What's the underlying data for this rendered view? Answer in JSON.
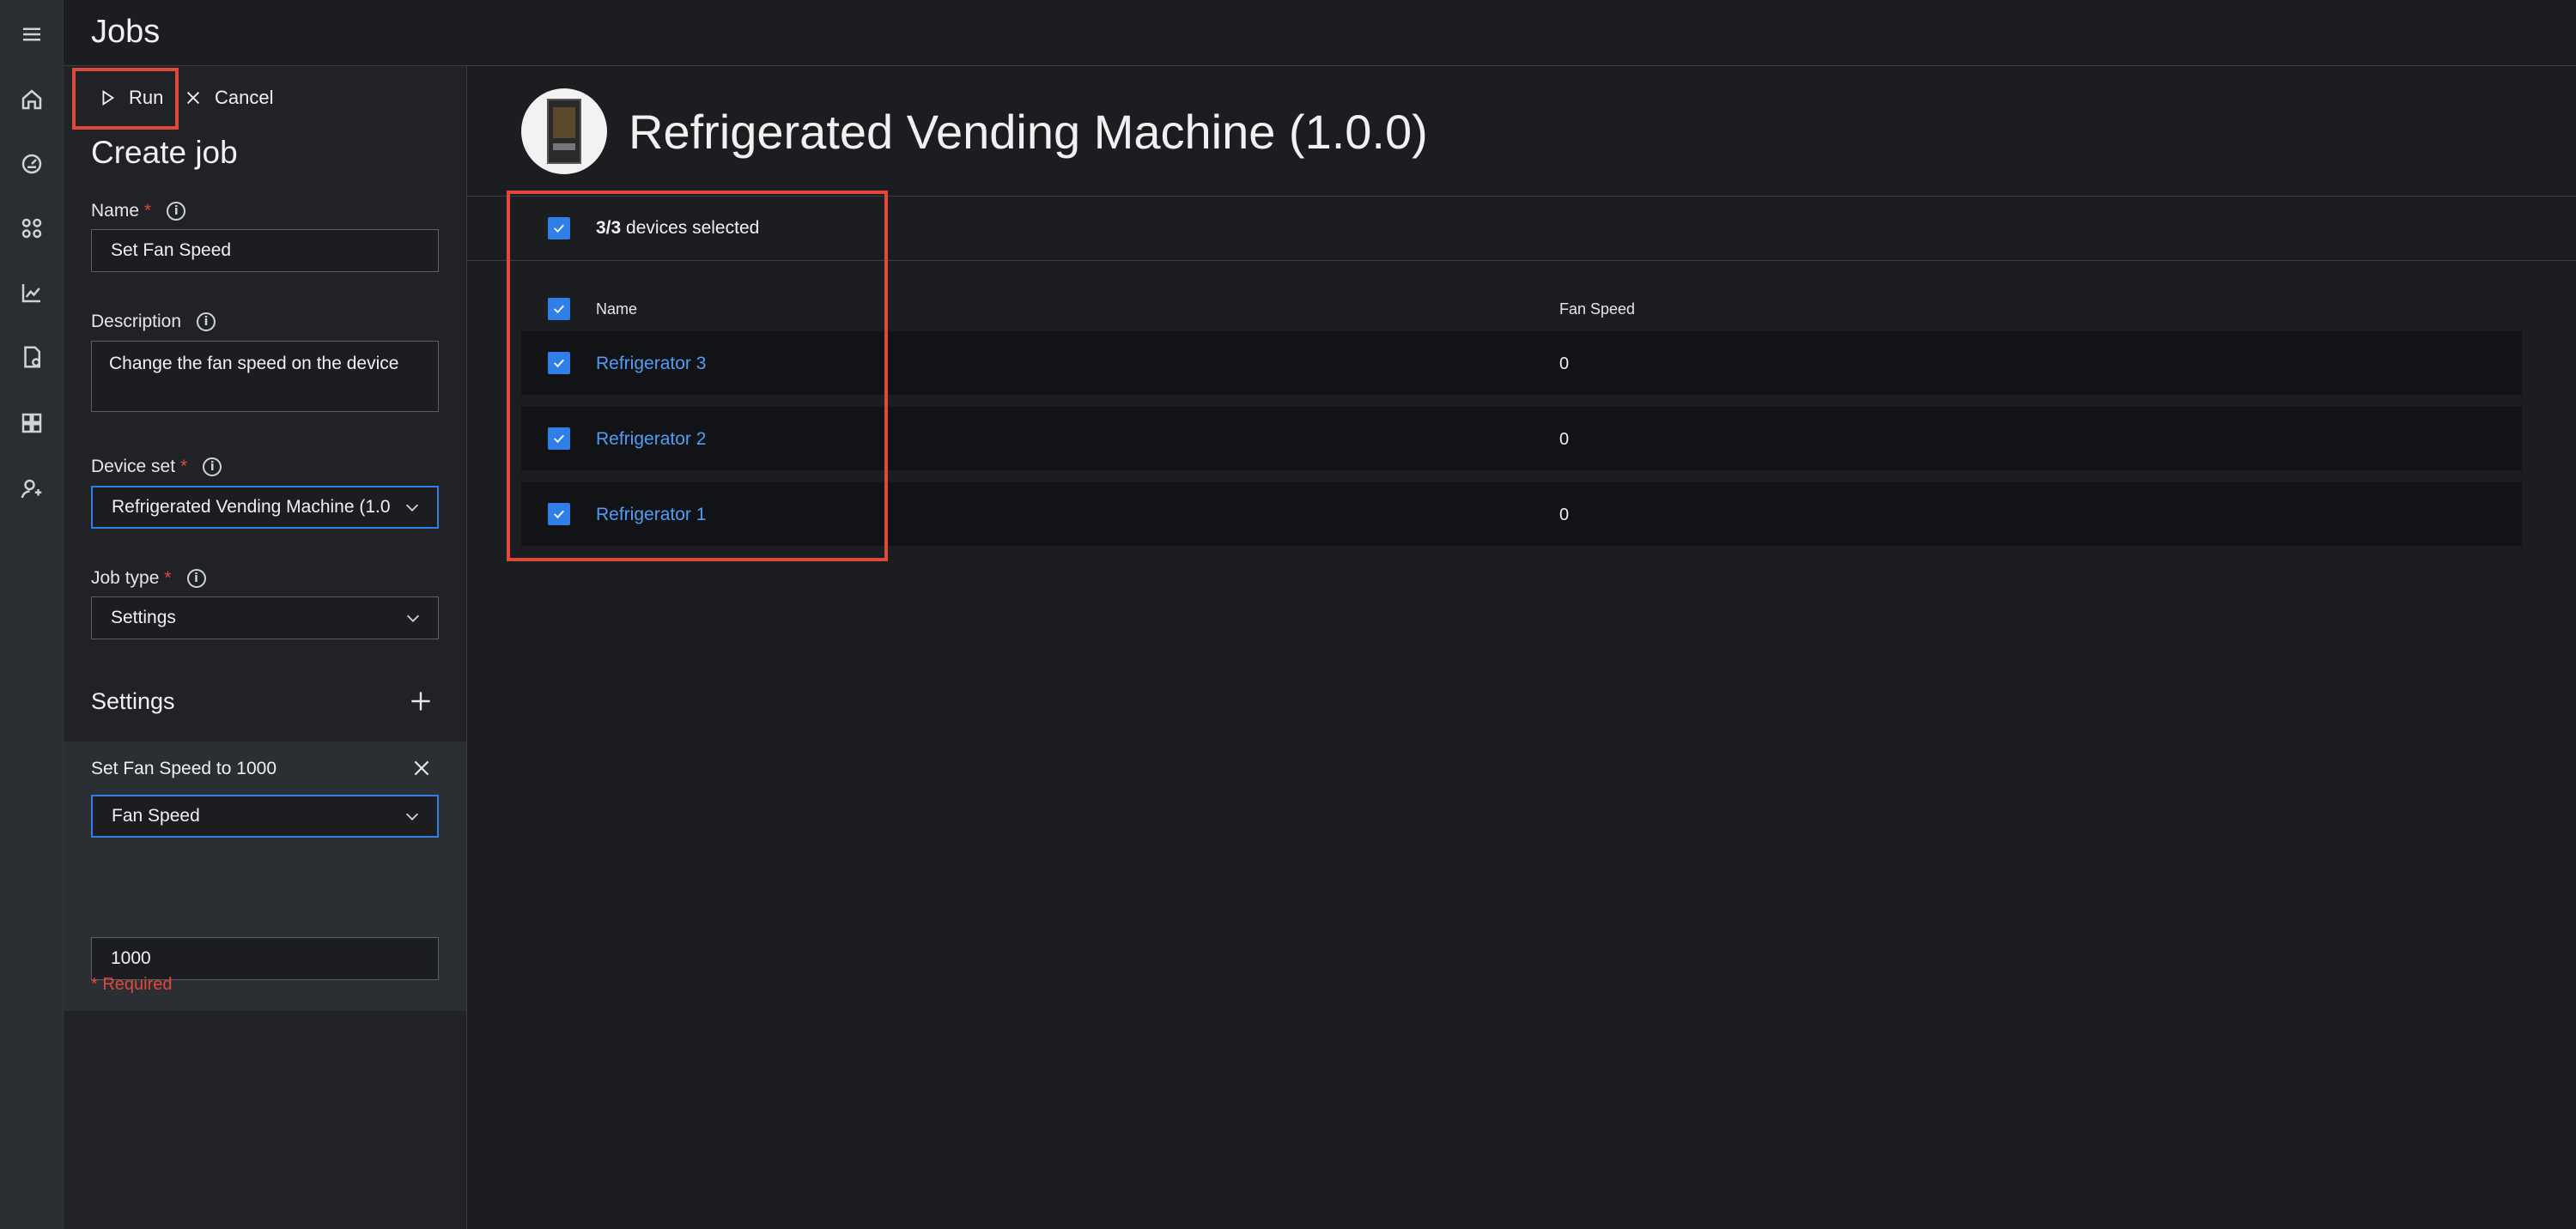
{
  "app": {
    "title": "Jobs"
  },
  "toolbar": {
    "run_label": "Run",
    "cancel_label": "Cancel"
  },
  "form": {
    "heading": "Create job",
    "name": {
      "label": "Name",
      "value": "Set Fan Speed"
    },
    "description": {
      "label": "Description",
      "value": "Change the fan speed on the device"
    },
    "device_set": {
      "label": "Device set",
      "value": "Refrigerated Vending Machine (1.0"
    },
    "job_type": {
      "label": "Job type",
      "value": "Settings"
    },
    "settings": {
      "heading": "Settings",
      "item_title": "Set Fan Speed to 1000",
      "property_value": "Fan Speed",
      "value": "1000"
    },
    "required_note": "* Required"
  },
  "required_marker": "*",
  "info_glyph": "i",
  "main": {
    "device_template_title": "Refrigerated Vending Machine (1.0.0)",
    "selection": {
      "count": "3/3",
      "suffix": "devices selected"
    },
    "table": {
      "columns": [
        "Name",
        "Fan Speed"
      ],
      "rows": [
        {
          "name": "Refrigerator 3",
          "fan_speed": "0"
        },
        {
          "name": "Refrigerator 2",
          "fan_speed": "0"
        },
        {
          "name": "Refrigerator 1",
          "fan_speed": "0"
        }
      ]
    }
  },
  "colors": {
    "accent": "#2f7fe8",
    "highlight": "#e0483c",
    "link": "#4d9ef5",
    "required": "#e0483c"
  },
  "icons": [
    "menu-icon",
    "home-icon",
    "dashboard-icon",
    "devices-icon",
    "analytics-icon",
    "jobs-icon",
    "app-settings-icon",
    "admin-icon",
    "play-icon",
    "close-icon",
    "info-icon",
    "chevron-down-icon",
    "plus-icon",
    "check-icon"
  ]
}
